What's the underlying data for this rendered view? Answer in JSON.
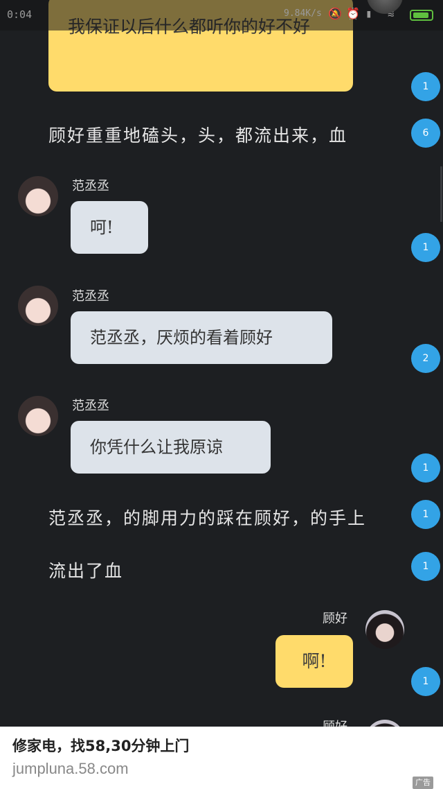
{
  "status_bar": {
    "time": "0:04",
    "net_speed": "9.84K/s",
    "colors": {
      "battery": "#5fbf3f"
    }
  },
  "messages": {
    "m1": "我保证以后什么都听你的好不好",
    "narration1": "顾好重重地磕头，头，都流出来，血",
    "m2_sender": "范丞丞",
    "m2": "呵!",
    "m3_sender": "范丞丞",
    "m3": "范丞丞，厌烦的看着顾好",
    "m4_sender": "范丞丞",
    "m4": "你凭什么让我原谅",
    "narration2": "范丞丞，的脚用力的踩在顾好，的手上",
    "narration3": "流出了血",
    "m5_sender": "顾好",
    "m5": "啊!",
    "m6_sender": "顾好"
  },
  "badges": [
    "1",
    "6",
    "1",
    "2",
    "1",
    "1",
    "1",
    "1"
  ],
  "ad": {
    "title": "修家电，找58,30分钟上门",
    "url": "jumpluna.58.com",
    "tag": "广告"
  },
  "colors": {
    "background": "#1d1f22",
    "bubble_right": "#ffdb6b",
    "bubble_left": "#dde3ea",
    "badge": "#33a3e6"
  }
}
